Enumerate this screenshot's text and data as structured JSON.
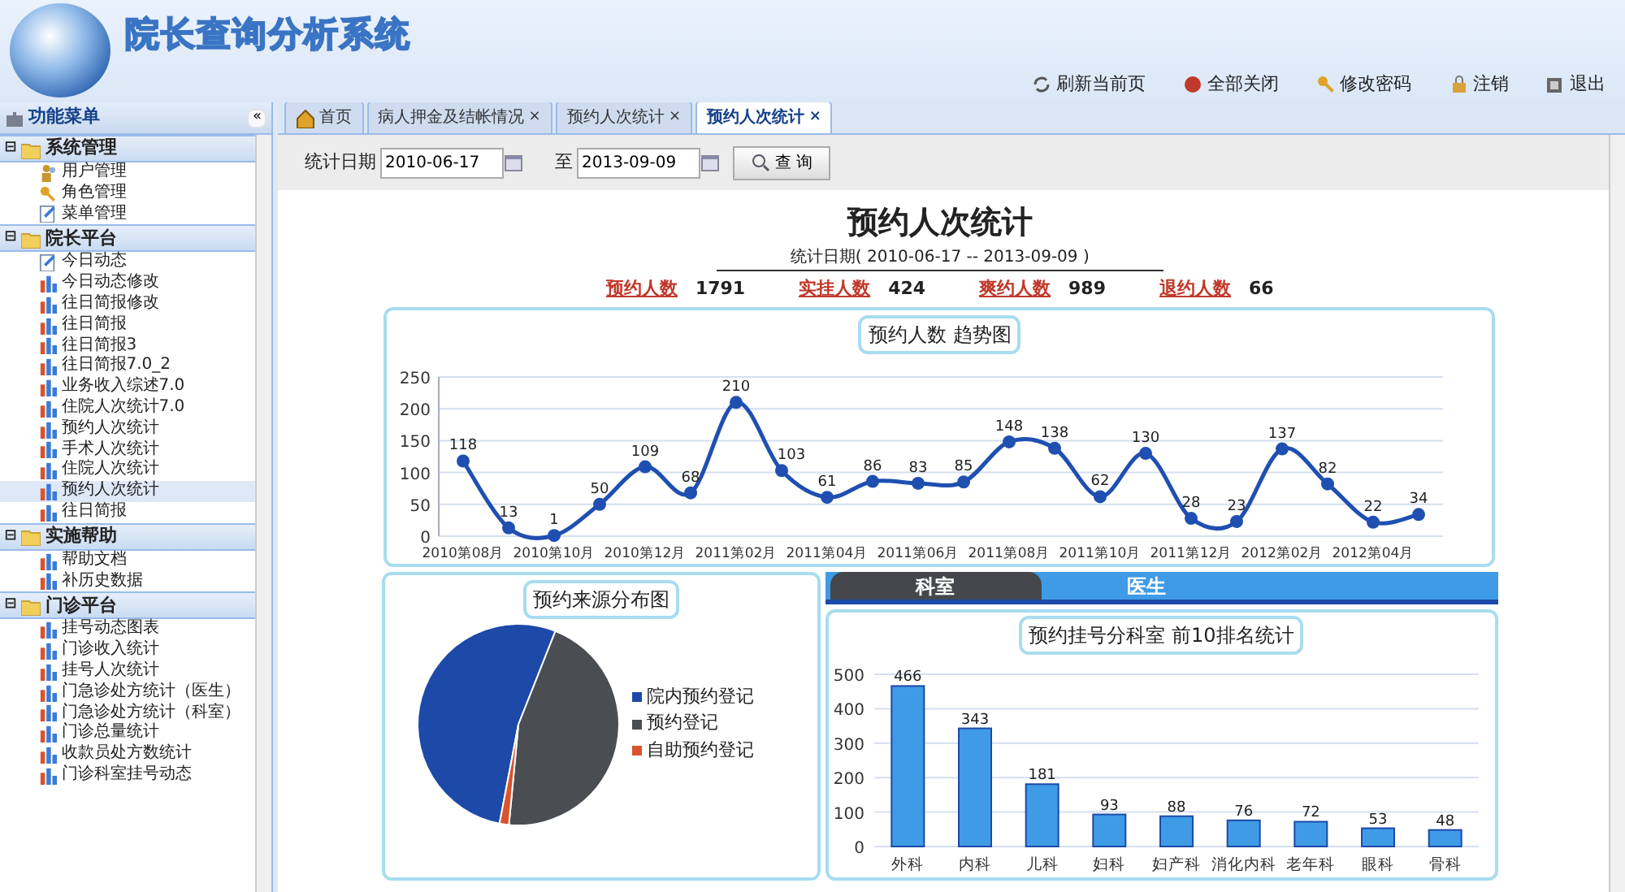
{
  "header": {
    "title": "院长查询分析系统",
    "toolbar": [
      {
        "label": "刷新当前页",
        "kind": "refresh"
      },
      {
        "label": "全部关闭",
        "kind": "close"
      },
      {
        "label": "修改密码",
        "kind": "key"
      },
      {
        "label": "注销",
        "kind": "lock"
      },
      {
        "label": "退出",
        "kind": "exit"
      }
    ]
  },
  "sidebar": {
    "title": "功能菜单",
    "collapse": "«",
    "groups": [
      {
        "label": "系统管理",
        "toggle": "⊟",
        "items": [
          {
            "label": "用户管理",
            "kind": "user",
            "selected": false
          },
          {
            "label": "角色管理",
            "kind": "key",
            "selected": false
          },
          {
            "label": "菜单管理",
            "kind": "doc",
            "selected": false
          }
        ]
      },
      {
        "label": "院长平台",
        "toggle": "⊟",
        "items": [
          {
            "label": "今日动态",
            "kind": "doc",
            "selected": false
          },
          {
            "label": "今日动态修改",
            "kind": "chart",
            "selected": false
          },
          {
            "label": "往日简报修改",
            "kind": "chart",
            "selected": false
          },
          {
            "label": "往日简报",
            "kind": "chart",
            "selected": false
          },
          {
            "label": "往日简报3",
            "kind": "chart",
            "selected": false
          },
          {
            "label": "往日简报7.0_2",
            "kind": "chart",
            "selected": false
          },
          {
            "label": "业务收入综述7.0",
            "kind": "chart",
            "selected": false
          },
          {
            "label": "住院人次统计7.0",
            "kind": "chart",
            "selected": false
          },
          {
            "label": "预约人次统计",
            "kind": "chart",
            "selected": false
          },
          {
            "label": "手术人次统计",
            "kind": "chart",
            "selected": false
          },
          {
            "label": "住院人次统计",
            "kind": "chart",
            "selected": false
          },
          {
            "label": "预约人次统计",
            "kind": "chart",
            "selected": true
          },
          {
            "label": "往日简报",
            "kind": "chart",
            "selected": false
          }
        ]
      },
      {
        "label": "实施帮助",
        "toggle": "⊟",
        "items": [
          {
            "label": "帮助文档",
            "kind": "chart",
            "selected": false
          },
          {
            "label": "补历史数据",
            "kind": "chart",
            "selected": false
          }
        ]
      },
      {
        "label": "门诊平台",
        "toggle": "⊟",
        "items": [
          {
            "label": "挂号动态图表",
            "kind": "chart",
            "selected": false
          },
          {
            "label": "门诊收入统计",
            "kind": "chart",
            "selected": false
          },
          {
            "label": "挂号人次统计",
            "kind": "chart",
            "selected": false
          },
          {
            "label": "门急诊处方统计（医生）",
            "kind": "chart",
            "selected": false
          },
          {
            "label": "门急诊处方统计（科室）",
            "kind": "chart",
            "selected": false
          },
          {
            "label": "门诊总量统计",
            "kind": "chart",
            "selected": false
          },
          {
            "label": "收款员处方数统计",
            "kind": "chart",
            "selected": false
          },
          {
            "label": "门诊科室挂号动态",
            "kind": "chart",
            "selected": false
          }
        ]
      }
    ]
  },
  "tabs": [
    {
      "label": "首页",
      "kind": "home",
      "selected": false
    },
    {
      "label": "病人押金及结帐情况",
      "kind": "closable",
      "close": "×",
      "selected": false
    },
    {
      "label": "预约人次统计",
      "kind": "closable",
      "close": "×",
      "selected": false
    },
    {
      "label": "预约人次统计",
      "kind": "closable",
      "close": "×",
      "selected": true
    }
  ],
  "filter": {
    "date_label": "统计日期",
    "start": "2010-06-17",
    "to_label": "至",
    "end": "2013-09-09",
    "query": "查 询"
  },
  "report": {
    "title": "预约人次统计",
    "subtitle": "统计日期( 2010-06-17 -- 2013-09-09 )",
    "summary": [
      {
        "label": "预约人数",
        "value": "1791"
      },
      {
        "label": "实挂人数",
        "value": "424"
      },
      {
        "label": "爽约人数",
        "value": "989"
      },
      {
        "label": "退约人数",
        "value": "66"
      }
    ]
  },
  "trend": {
    "title": "预约人数 趋势图",
    "chart_data": {
      "type": "line",
      "categories": [
        "2010第08月",
        null,
        "2010第10月",
        null,
        "2010第12月",
        null,
        "2011第02月",
        null,
        "2011第04月",
        null,
        "2011第06月",
        null,
        "2011第08月",
        null,
        "2011第10月",
        null,
        "2011第12月",
        null,
        "2012第02月",
        null,
        "2012第04月",
        null
      ],
      "series": [
        {
          "color": "#1f4fb0",
          "marker": true,
          "values": [
            118,
            13,
            1,
            50,
            109,
            68,
            210,
            103,
            61,
            86,
            83,
            85,
            148,
            138,
            62,
            130,
            28,
            23,
            137,
            82,
            22,
            34
          ]
        }
      ],
      "data_labels": true,
      "grid": true,
      "ylim": [
        0,
        250
      ],
      "yticks": [
        0,
        50,
        100,
        150,
        200,
        250
      ]
    }
  },
  "source": {
    "title": "预约来源分布图",
    "legend": [
      {
        "label": "院内预约登记",
        "color": "#1d4aa8"
      },
      {
        "label": "预约登记",
        "color": "#4a4d52"
      },
      {
        "label": "自助预约登记",
        "color": "#d9532c"
      }
    ]
  },
  "subtabs": [
    {
      "label": "科室",
      "selected": true
    },
    {
      "label": "医生",
      "selected": false
    }
  ],
  "ranking": {
    "title": "预约挂号分科室 前10排名统计",
    "chart_data": {
      "type": "bar",
      "categories": [
        "外科",
        "内科",
        "儿科",
        "妇科",
        "妇产科",
        "消化内科",
        "老年科",
        "眼科",
        "骨科"
      ],
      "series": [
        {
          "color": "#3f9be6",
          "values": [
            466,
            343,
            181,
            93,
            88,
            76,
            72,
            53,
            48
          ]
        }
      ],
      "data_labels": true,
      "grid": true,
      "ylim": [
        0,
        500
      ],
      "yticks": [
        0,
        100,
        200,
        300,
        400,
        500
      ]
    }
  }
}
